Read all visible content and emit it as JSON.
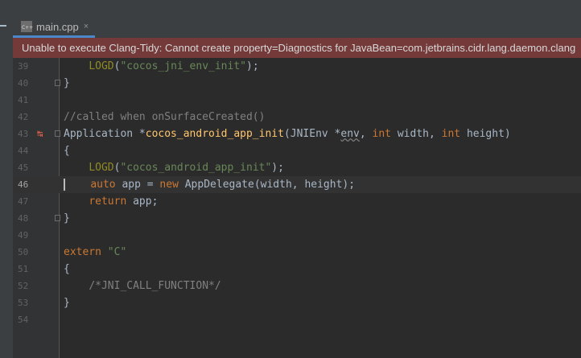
{
  "tab": {
    "label": "main.cpp",
    "close": "×"
  },
  "banner": {
    "text": "Unable to execute Clang-Tidy: Cannot create property=Diagnostics for JavaBean=com.jetbrains.cidr.lang.daemon.clang"
  },
  "lines": [
    {
      "n": "39",
      "code": [
        {
          "t": "    "
        },
        {
          "t": "LOGD",
          "c": "mac"
        },
        {
          "t": "("
        },
        {
          "t": "\"cocos_jni_env_init\"",
          "c": "str"
        },
        {
          "t": ");"
        }
      ]
    },
    {
      "n": "40",
      "code": [
        {
          "t": "}"
        }
      ]
    },
    {
      "n": "41",
      "code": []
    },
    {
      "n": "42",
      "code": [
        {
          "t": "//called when onSurfaceCreated()",
          "c": "cm"
        }
      ]
    },
    {
      "n": "43",
      "code": [
        {
          "t": "Application *"
        },
        {
          "t": "cocos_android_app_init",
          "c": "fn"
        },
        {
          "t": "(JNIEnv *"
        },
        {
          "t": "env",
          "c": "param"
        },
        {
          "t": ", "
        },
        {
          "t": "int",
          "c": "kw"
        },
        {
          "t": " width, "
        },
        {
          "t": "int",
          "c": "kw"
        },
        {
          "t": " height)"
        }
      ]
    },
    {
      "n": "44",
      "code": [
        {
          "t": "{"
        }
      ]
    },
    {
      "n": "45",
      "code": [
        {
          "t": "    "
        },
        {
          "t": "LOGD",
          "c": "mac"
        },
        {
          "t": "("
        },
        {
          "t": "\"cocos_android_app_init\"",
          "c": "str"
        },
        {
          "t": ");"
        }
      ]
    },
    {
      "n": "46",
      "code": [
        {
          "t": "    "
        },
        {
          "t": "auto",
          "c": "kw"
        },
        {
          "t": " app = "
        },
        {
          "t": "new",
          "c": "kw"
        },
        {
          "t": " AppDelegate(width, height);"
        }
      ]
    },
    {
      "n": "47",
      "code": [
        {
          "t": "    "
        },
        {
          "t": "return",
          "c": "kw"
        },
        {
          "t": " app;"
        }
      ]
    },
    {
      "n": "48",
      "code": [
        {
          "t": "}"
        }
      ]
    },
    {
      "n": "49",
      "code": []
    },
    {
      "n": "50",
      "code": [
        {
          "t": "extern",
          "c": "kw"
        },
        {
          "t": " "
        },
        {
          "t": "\"C\"",
          "c": "str"
        }
      ]
    },
    {
      "n": "51",
      "code": [
        {
          "t": "{"
        }
      ]
    },
    {
      "n": "52",
      "code": [
        {
          "t": "    "
        },
        {
          "t": "/*JNI_CALL_FUNCTION*/",
          "c": "cm"
        }
      ]
    },
    {
      "n": "53",
      "code": [
        {
          "t": "}"
        }
      ]
    },
    {
      "n": "54",
      "code": []
    }
  ],
  "current_line": "46",
  "fold_lines": [
    "40",
    "43",
    "48"
  ],
  "gutter_icon": {
    "line": "43",
    "name": "override-arrow-icon",
    "glyph": "↹"
  },
  "colors": {
    "keyword": "#cc7832",
    "string": "#6a8759",
    "comment": "#808080",
    "function": "#ffc66d",
    "macro": "#908b25",
    "banner": "#743a3a"
  }
}
